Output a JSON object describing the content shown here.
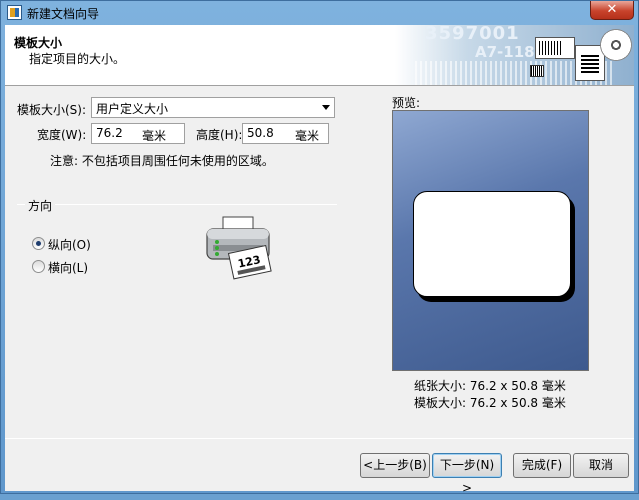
{
  "window": {
    "title": "新建文档向导",
    "close_symbol": "✕"
  },
  "header": {
    "title": "模板大小",
    "subtitle": "指定项目的大小。",
    "banner_text1": "3597001",
    "banner_text2": "A7-118"
  },
  "form": {
    "template_size_label": "模板大小(S):",
    "template_size_value": "用户定义大小",
    "width_label": "宽度(W):",
    "width_value": "76.2",
    "width_unit": "毫米",
    "height_label": "高度(H):",
    "height_value": "50.8",
    "height_unit": "毫米",
    "note": "注意: 不包括项目周围任何未使用的区域。"
  },
  "orientation": {
    "group_label": "方向",
    "portrait_label": "纵向(O)",
    "landscape_label": "横向(L)",
    "selected": "portrait",
    "printer_label_text": "123"
  },
  "preview": {
    "title": "预览:",
    "paper_size": "纸张大小:  76.2 x 50.8 毫米",
    "template_size": "模板大小:  76.2 x 50.8 毫米"
  },
  "buttons": {
    "back": "<上一步(B)",
    "next": "下一步(N) >",
    "finish": "完成(F)",
    "cancel": "取消"
  },
  "colors": {
    "preview_bg": "#4a66a0",
    "titlebar": "#6aa0d0",
    "close": "#c8432c"
  }
}
